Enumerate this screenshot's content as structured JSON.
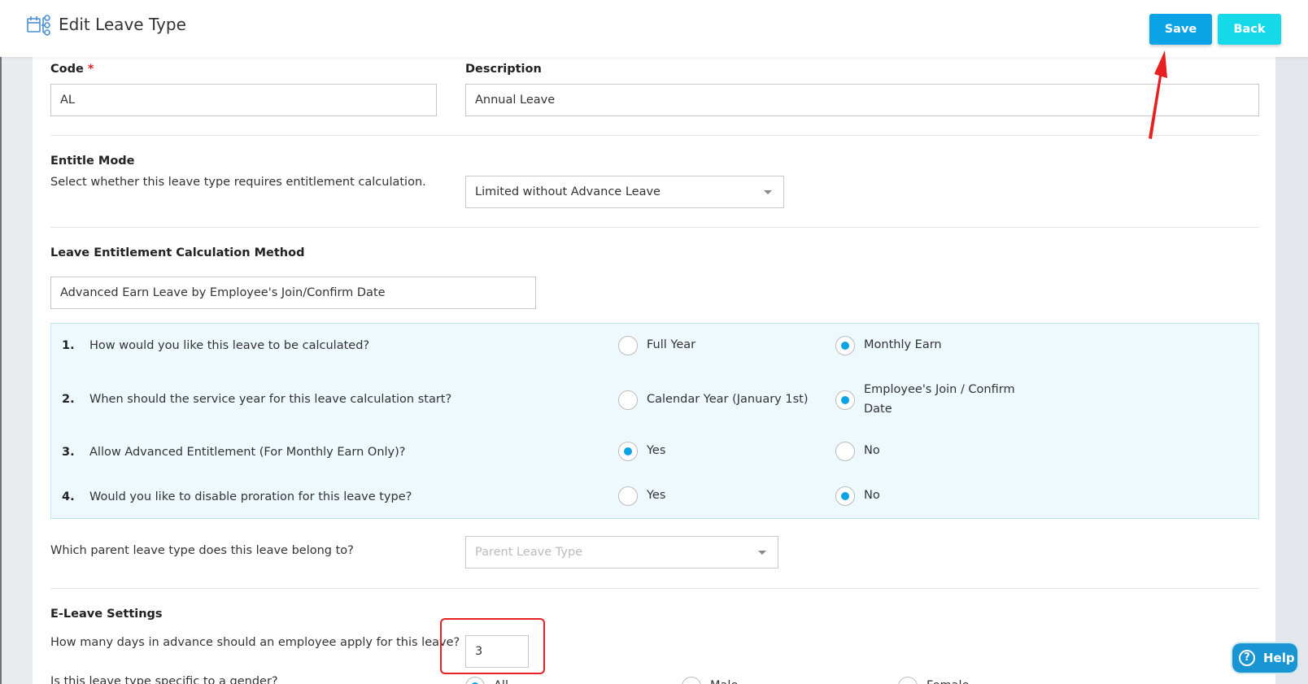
{
  "header": {
    "title": "Edit Leave Type",
    "save_label": "Save",
    "back_label": "Back"
  },
  "form": {
    "code_label": "Code",
    "code_required": "*",
    "code_value": "AL",
    "description_label": "Description",
    "description_value": "Annual Leave",
    "entitle_mode_label": "Entitle Mode",
    "entitle_mode_help": "Select whether this leave type requires entitlement calculation.",
    "entitle_mode_value": "Limited without Advance Leave",
    "calc_method_label": "Leave Entitlement Calculation Method",
    "calc_method_value": "Advanced Earn Leave by Employee's Join/Confirm Date",
    "questions": [
      {
        "num": "1.",
        "text": "How would you like this leave to be calculated?",
        "option_a": "Full Year",
        "option_b": "Monthly Earn",
        "selected": "b"
      },
      {
        "num": "2.",
        "text": "When should the service year for this leave calculation start?",
        "option_a": "Calendar Year (January 1st)",
        "option_b": "Employee's Join / Confirm Date",
        "selected": "b"
      },
      {
        "num": "3.",
        "text": "Allow Advanced Entitlement (For Monthly Earn Only)?",
        "option_a": "Yes",
        "option_b": "No",
        "selected": "a"
      },
      {
        "num": "4.",
        "text": "Would you like to disable proration for this leave type?",
        "option_a": "Yes",
        "option_b": "No",
        "selected": "b"
      }
    ],
    "parent_question": "Which parent leave type does this leave belong to?",
    "parent_placeholder": "Parent Leave Type",
    "eleave_label": "E-Leave Settings",
    "advance_question": "How many days in advance should an employee apply for this leave?",
    "advance_value": "3",
    "gender_question": "Is this leave type specific to a gender?",
    "gender_options": [
      "All",
      "Male",
      "Female"
    ]
  },
  "help": {
    "label": "Help",
    "icon": "?"
  },
  "colors": {
    "primary": "#0aa3e6",
    "back": "#15d9e9",
    "annotation": "#e62020"
  }
}
